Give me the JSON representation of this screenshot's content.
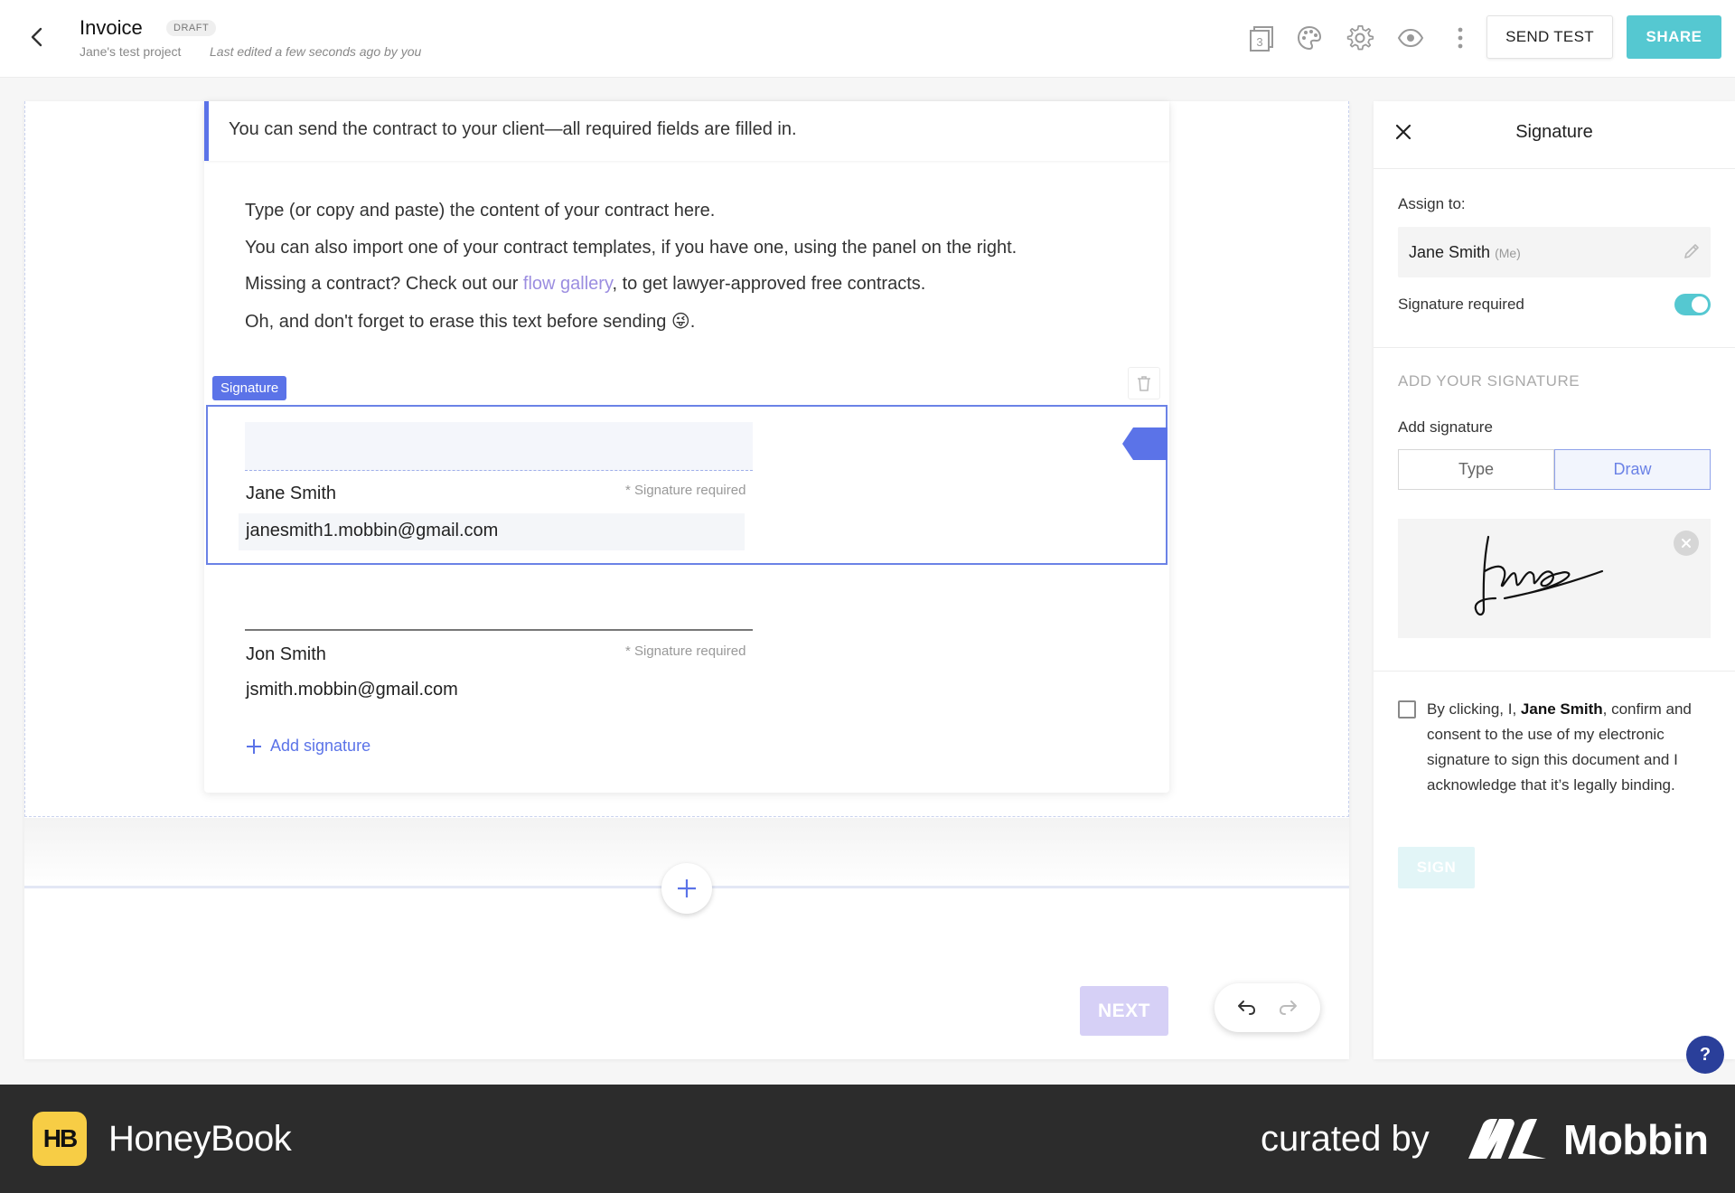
{
  "header": {
    "title": "Invoice",
    "status_badge": "DRAFT",
    "project": "Jane's test project",
    "last_edited": "Last edited a few seconds ago by you",
    "pages_count": "3",
    "send_test_label": "SEND TEST",
    "share_label": "SHARE",
    "icons": [
      "back-icon",
      "pages-icon",
      "palette-icon",
      "gear-icon",
      "eye-icon",
      "more-vertical-icon"
    ],
    "share_color": "#55c8d1"
  },
  "document": {
    "notice": "You can send the contract to your client—all required fields are filled in.",
    "paragraphs": {
      "p1": "Type (or copy and paste) the content of your contract here.",
      "p2": "You can also import one of your contract templates, if you have one, using the panel on the right.",
      "p3_before": "Missing a contract? Check out our ",
      "p3_link": "flow gallery",
      "p3_after": ", to get lawyer-approved free contracts.",
      "p4": "Oh, and don't forget to erase this text before sending 😜."
    },
    "signature_tag": "Signature",
    "signers": [
      {
        "name": "Jane Smith",
        "required": "* Signature required",
        "email": "janesmith1.mobbin@gmail.com"
      },
      {
        "name": "Jon Smith",
        "required": "* Signature required",
        "email": "jsmith.mobbin@gmail.com"
      }
    ],
    "add_signature": "Add signature",
    "next_label": "NEXT",
    "accent_color": "#5b73e8"
  },
  "panel": {
    "title": "Signature",
    "assign_label": "Assign to:",
    "assignee": "Jane Smith",
    "assignee_suffix": "(Me)",
    "signature_required_label": "Signature required",
    "signature_required": true,
    "section_heading": "ADD YOUR SIGNATURE",
    "add_signature_label": "Add signature",
    "mode_options": [
      "Type",
      "Draw"
    ],
    "selected_mode": "Draw",
    "consent_before": "By clicking, I, ",
    "consent_name": "Jane Smith",
    "consent_after": ", confirm and consent to the use of my electronic signature to sign this document and I acknowledge that it’s legally binding.",
    "sign_label": "SIGN",
    "help_label": "?"
  },
  "footer": {
    "brand_logo_text": "HB",
    "brand": "HoneyBook",
    "curated_by": "curated by",
    "curator": "Mobbin"
  }
}
